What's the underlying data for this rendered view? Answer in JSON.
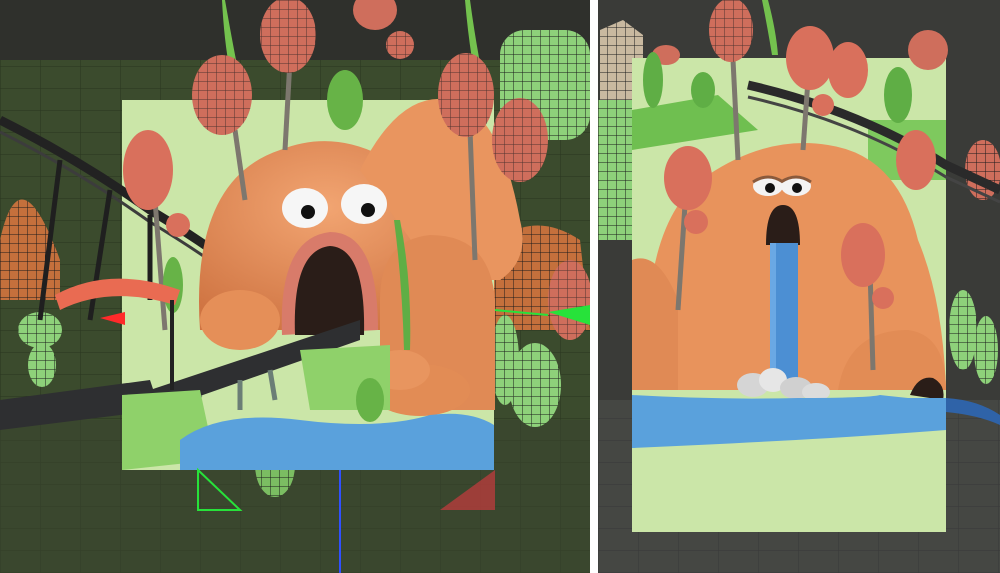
{
  "views": [
    {
      "id": "viewport-left",
      "description_free": true
    },
    {
      "id": "viewport-right",
      "description_free": true
    }
  ],
  "colors": {
    "viewport_floor": "#3a4a2c",
    "viewport_sky": "#2e2f2c",
    "render_background": "#cbe6a8",
    "hill_orange": "#e8935c",
    "hill_shadow": "#c96f3e",
    "tree_red": "#d9705c",
    "water_blue": "#5aa1dc",
    "grass_green": "#6fbf50",
    "road_dark": "#2f3032",
    "wire_green": "#97d986",
    "gizmo_red": "#ff2a2a",
    "gizmo_green": "#27e23a",
    "gizmo_blue": "#3050ff"
  }
}
